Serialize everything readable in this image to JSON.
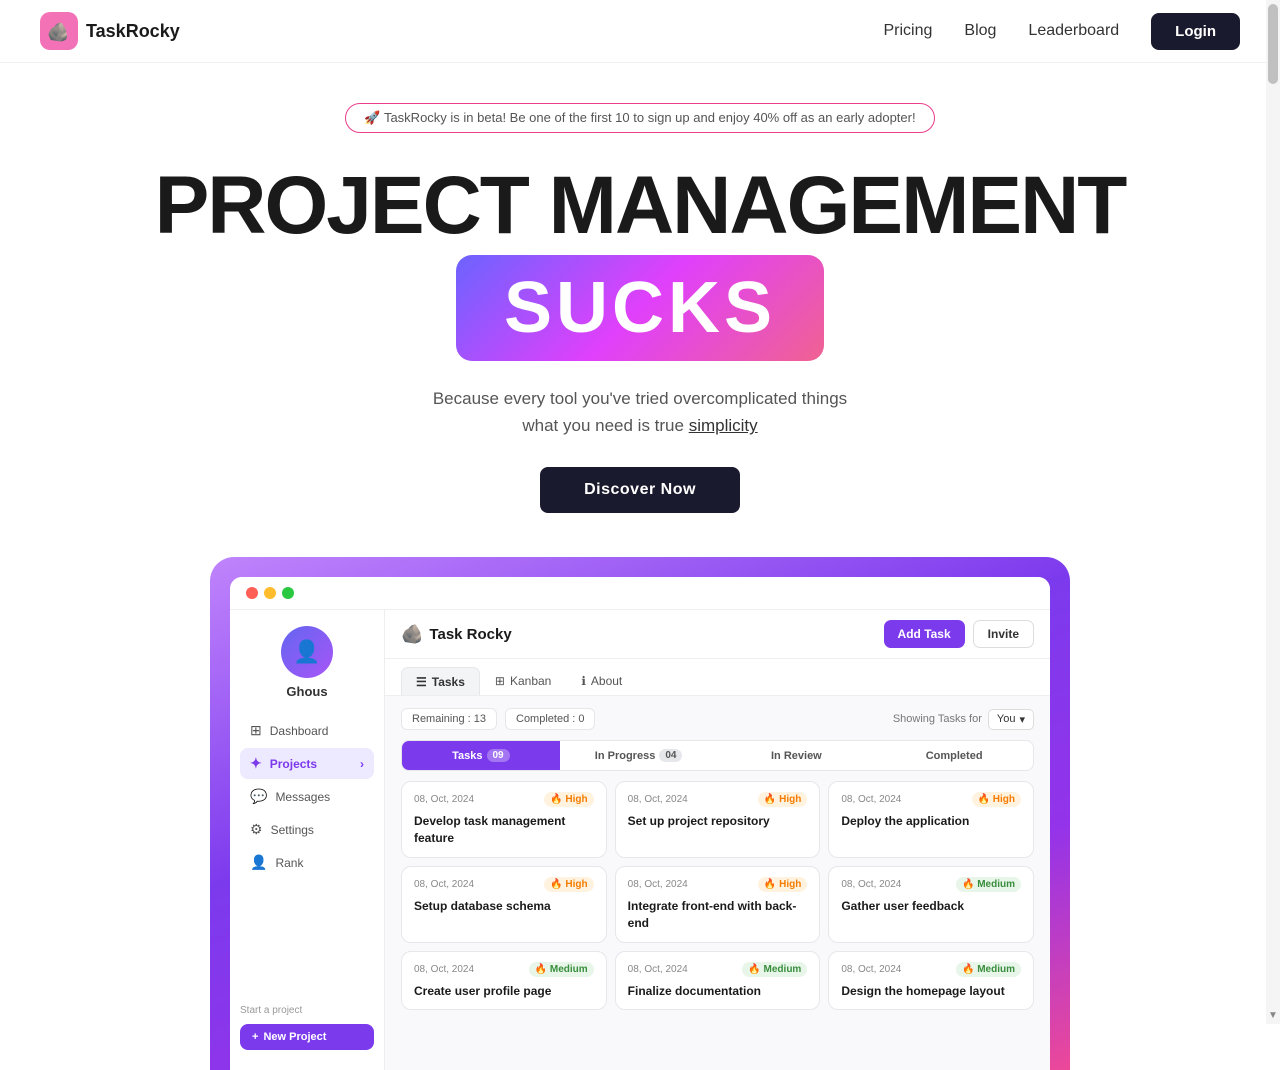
{
  "brand": {
    "name": "TaskRocky",
    "logo_emoji": "🪨"
  },
  "navbar": {
    "logo_text": "TaskRocky",
    "links": [
      {
        "label": "Pricing",
        "id": "pricing"
      },
      {
        "label": "Blog",
        "id": "blog"
      },
      {
        "label": "Leaderboard",
        "id": "leaderboard"
      }
    ],
    "login_label": "Login"
  },
  "beta_banner": "🚀 TaskRocky is in beta! Be one of the first 10 to sign up and enjoy 40% off as an early adopter!",
  "hero": {
    "title_main": "PROJECT MANAGEMENT",
    "title_sucks": "SUCKS",
    "subtitle_line1": "Because every tool you've tried overcomplicated things",
    "subtitle_line2": "what you need is true ",
    "subtitle_simplicity": "simplicity",
    "cta_label": "Discover Now"
  },
  "app_preview": {
    "user_name": "Ghous",
    "main_logo": "Task Rocky",
    "sidebar_items": [
      {
        "label": "Dashboard",
        "icon": "⊞",
        "active": false
      },
      {
        "label": "Projects",
        "icon": "✦",
        "active": true
      },
      {
        "label": "Messages",
        "icon": "💬",
        "active": false
      },
      {
        "label": "Settings",
        "icon": "⚙",
        "active": false
      },
      {
        "label": "Rank",
        "icon": "👤",
        "active": false
      }
    ],
    "start_project_label": "Start a project",
    "new_project_label": "New Project",
    "header_add_task": "Add Task",
    "header_invite": "Invite",
    "tabs": [
      {
        "label": "Tasks",
        "icon": "☰",
        "active": true
      },
      {
        "label": "Kanban",
        "icon": "⊞",
        "active": false
      },
      {
        "label": "About",
        "icon": "ℹ",
        "active": false
      }
    ],
    "remaining": "Remaining : 13",
    "completed": "Completed : 0",
    "showing_tasks_for": "Showing Tasks for",
    "showing_for_value": "You",
    "column_headers": [
      {
        "label": "Tasks",
        "count": "09",
        "active": true
      },
      {
        "label": "In Progress",
        "count": "04",
        "active": false
      },
      {
        "label": "In Review",
        "count": "",
        "active": false
      },
      {
        "label": "Completed",
        "count": "",
        "active": false
      }
    ],
    "tasks": [
      {
        "date": "08, Oct, 2024",
        "priority": "High",
        "priority_type": "high",
        "title": "Develop task management feature"
      },
      {
        "date": "08, Oct, 2024",
        "priority": "High",
        "priority_type": "high",
        "title": "Set up project repository"
      },
      {
        "date": "08, Oct, 2024",
        "priority": "High",
        "priority_type": "high",
        "title": "Deploy the application"
      },
      {
        "date": "08, Oct, 2024",
        "priority": "High",
        "priority_type": "high",
        "title": "Setup database schema"
      },
      {
        "date": "08, Oct, 2024",
        "priority": "High",
        "priority_type": "high",
        "title": "Integrate front-end with back-end"
      },
      {
        "date": "08, Oct, 2024",
        "priority": "Medium",
        "priority_type": "medium",
        "title": "Gather user feedback"
      },
      {
        "date": "08, Oct, 2024",
        "priority": "Medium",
        "priority_type": "medium",
        "title": "Create user profile page"
      },
      {
        "date": "08, Oct, 2024",
        "priority": "Medium",
        "priority_type": "medium",
        "title": "Finalize documentation"
      },
      {
        "date": "08, Oct, 2024",
        "priority": "Medium",
        "priority_type": "medium",
        "title": "Design the homepage layout"
      }
    ]
  }
}
